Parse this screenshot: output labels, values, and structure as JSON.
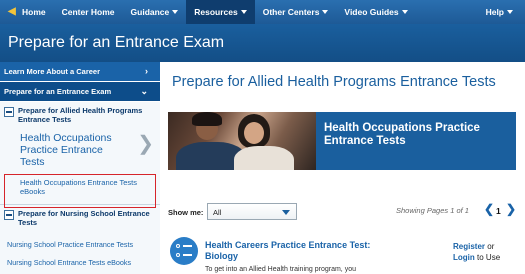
{
  "nav": {
    "items": [
      {
        "label": "Home",
        "icon": "home-icon"
      },
      {
        "label": "Center Home"
      },
      {
        "label": "Guidance",
        "dropdown": true
      },
      {
        "label": "Resources",
        "dropdown": true,
        "active": true
      },
      {
        "label": "Other Centers",
        "dropdown": true
      },
      {
        "label": "Video Guides",
        "dropdown": true
      }
    ],
    "help": "Help"
  },
  "banner": {
    "title": "Prepare for an Entrance Exam"
  },
  "sidebar": {
    "learn_more": "Learn More About a Career",
    "prepare": "Prepare for an Entrance Exam",
    "group_allied": "Prepare for Allied Health Programs Entrance Tests",
    "hop_item": "Health Occupations Practice Entrance Tests",
    "hop_ebooks": "Health Occupations Entrance Tests eBooks",
    "group_nursing": "Prepare for Nursing School Entrance Tests",
    "nursing_practice": "Nursing School Practice Entrance Tests",
    "nursing_ebooks": "Nursing School Entrance Tests eBooks"
  },
  "main": {
    "title": "Prepare for Allied Health Programs Entrance Tests",
    "hero_text": "Health Occupations Practice Entrance Tests",
    "show_me_label": "Show me:",
    "show_me_value": "All",
    "paging": "Showing Pages 1 of 1",
    "page_number": "1",
    "result": {
      "title": "Health Careers Practice Entrance Test: Biology",
      "register": "Register",
      "or": "or",
      "login": "Login",
      "to_use": "to Use",
      "desc": "To get into an Allied Health training program, you"
    }
  },
  "colors": {
    "nav": "#1e5a96",
    "banner": "#134e86",
    "accent": "#1a63a8",
    "highlight": "#d6242a"
  }
}
